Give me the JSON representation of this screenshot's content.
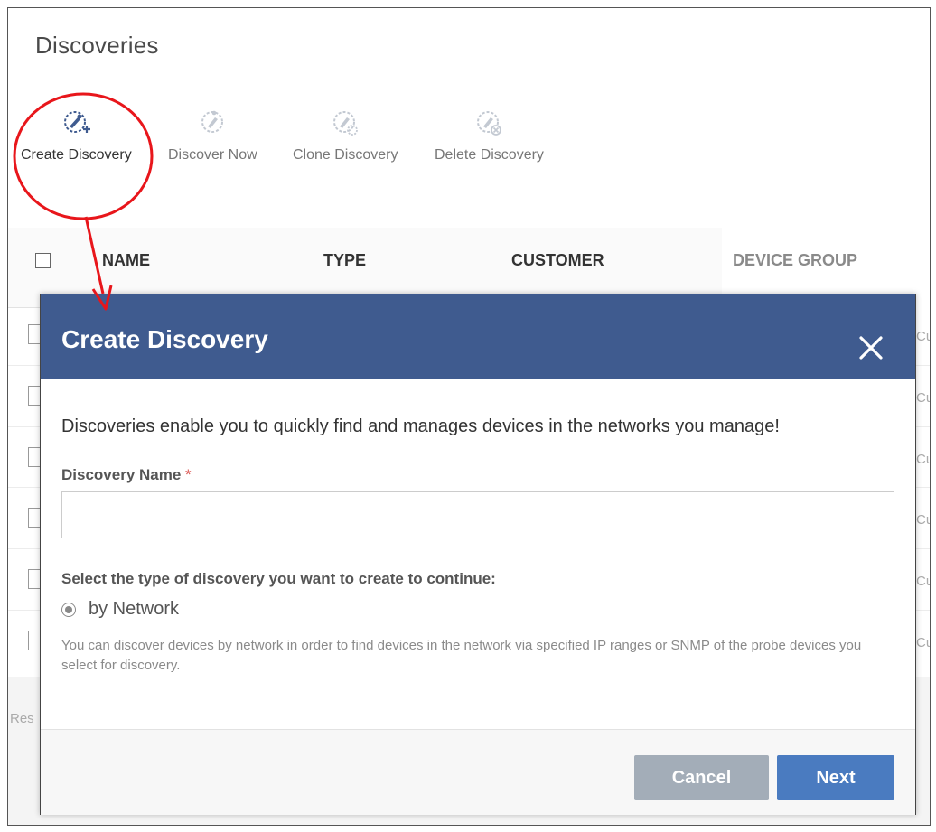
{
  "page": {
    "title": "Discoveries"
  },
  "toolbar": {
    "create": "Create Discovery",
    "discover_now": "Discover Now",
    "clone": "Clone Discovery",
    "delete": "Delete Discovery"
  },
  "table": {
    "columns": [
      "NAME",
      "TYPE",
      "CUSTOMER",
      "DEVICE GROUP"
    ],
    "right_cut_text": "Cu",
    "results_text": "Res"
  },
  "modal": {
    "title": "Create Discovery",
    "intro": "Discoveries enable you to quickly find and manages devices in the networks you manage!",
    "name_label": "Discovery Name",
    "required_mark": "*",
    "name_value": "",
    "type_label": "Select the type of discovery you want to create to continue:",
    "option_label": "by Network",
    "option_selected": true,
    "option_description": "You can discover devices by network in order to find devices in the network via specified IP ranges or SNMP of the probe devices you select for discovery.",
    "cancel_label": "Cancel",
    "next_label": "Next"
  },
  "colors": {
    "header_blue": "#3f5b8f",
    "next_blue": "#4a7bc0",
    "cancel_gray": "#a3adb8",
    "annotation_red": "#e8161b"
  },
  "icons": {
    "create": "create-discovery-icon",
    "discover_now": "discover-now-icon",
    "clone": "clone-discovery-icon",
    "delete": "delete-discovery-icon",
    "close": "close-icon"
  }
}
